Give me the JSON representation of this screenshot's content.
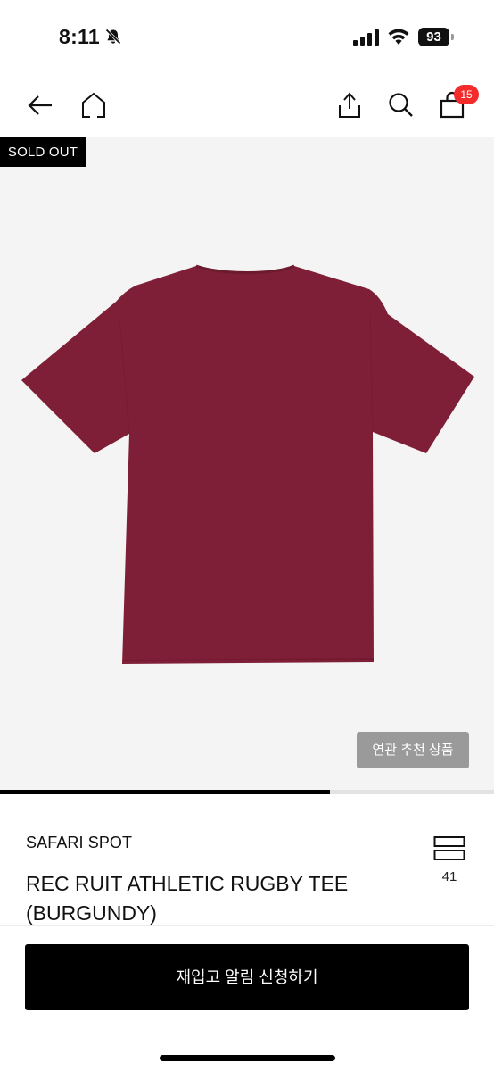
{
  "status_bar": {
    "time": "8:11",
    "battery": "93",
    "icons": [
      "bell-slash-icon",
      "signal-icon",
      "wifi-icon",
      "battery-icon"
    ]
  },
  "nav": {
    "icons": [
      "back-arrow-icon",
      "home-icon",
      "share-icon",
      "search-icon",
      "shopping-bag-icon"
    ],
    "cart_count": "15"
  },
  "product": {
    "sold_out_label": "SOLD OUT",
    "image_color": "#7f1f37",
    "related_button": "연관 추천 상품",
    "image_progress": 0.667,
    "brand": "SAFARI SPOT",
    "name": "REC RUIT ATHLETIC RUGBY TEE (BURGUNDY)",
    "like_count": "41"
  },
  "action": {
    "restock_button": "재입고 알림 신청하기"
  },
  "colors": {
    "badge_red": "#f42b2b",
    "button_black": "#000000",
    "image_bg": "#f4f4f4"
  }
}
